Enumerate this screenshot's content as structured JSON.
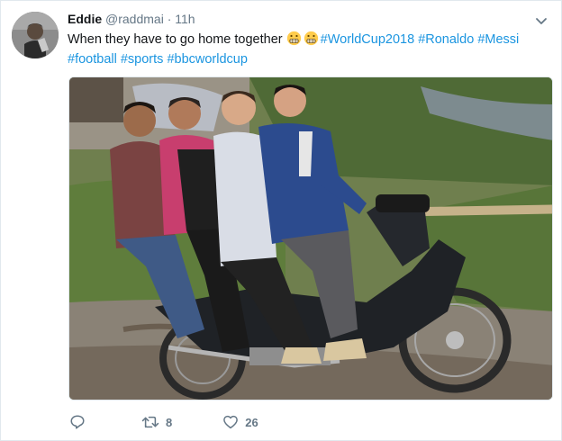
{
  "tweet": {
    "display_name": "Eddie",
    "handle": "@raddmai",
    "separator": "·",
    "time": "11h",
    "text_prefix": "When they have to go home together ",
    "emojis": [
      "grimacing-emoji",
      "grimacing-emoji"
    ],
    "hashtags_line1": [
      "#WorldCup2018",
      "#Ronaldo",
      "#Messi"
    ],
    "hashtags_line2": [
      "#football",
      "#sports",
      "#bbcworldcup"
    ]
  },
  "media": {
    "subject": "four-men-on-motorbike-photo"
  },
  "actions": {
    "reply_icon": "reply-icon",
    "retweet_icon": "retweet-icon",
    "retweet_count": "8",
    "like_icon": "heart-icon",
    "like_count": "26"
  },
  "colors": {
    "link": "#1b95e0",
    "secondary_text": "#657786",
    "border": "#e1e8ed"
  }
}
